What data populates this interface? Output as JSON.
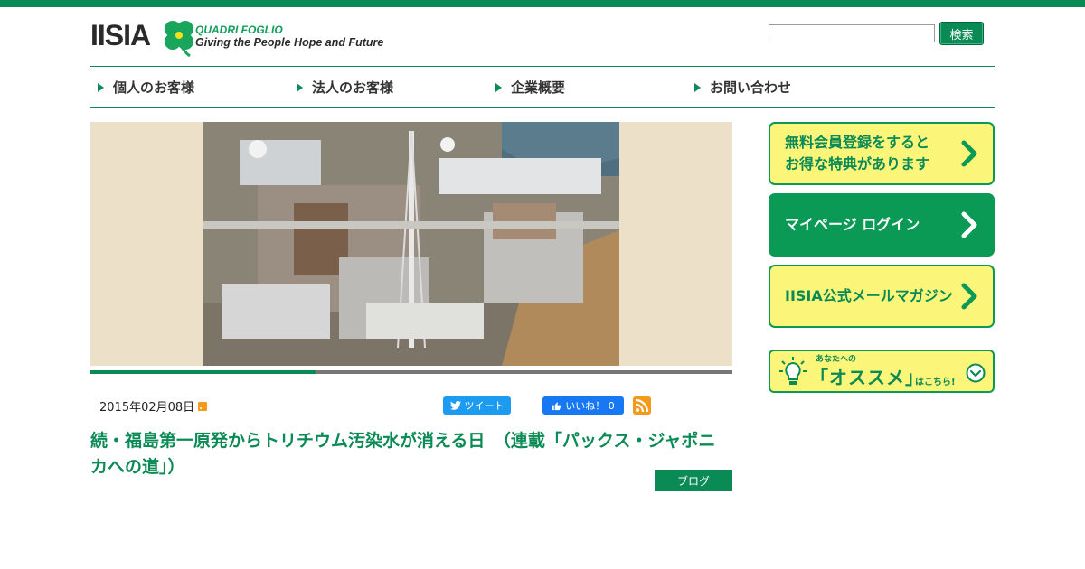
{
  "header": {
    "logo_text": "IISIA",
    "logo_sub1": "QUADRI FOGLIO",
    "logo_sub2": "Giving the People Hope and Future",
    "search_button": "検索",
    "search_value": ""
  },
  "nav": {
    "items": [
      {
        "label": "個人のお客様"
      },
      {
        "label": "法人のお客様"
      },
      {
        "label": "企業概要"
      },
      {
        "label": "お問い合わせ"
      }
    ]
  },
  "hero": {
    "slider_progress": 0.35
  },
  "post": {
    "date": "2015年02月08日",
    "tweet_label": "ツイート",
    "like_label": "いいね！ 0",
    "title": "続・福島第一原発からトリチウム汚染水が消える日　（連載「パックス・ジャポニカへの道」）",
    "category": "ブログ"
  },
  "sidebar": {
    "banners": [
      {
        "text_line1": "無料会員登録をすると",
        "text_line2": "お得な特典があります",
        "style": "yellow"
      },
      {
        "text_line1": "マイページ ログイン",
        "text_line2": "",
        "style": "green"
      },
      {
        "text_line1": "IISIA公式メールマガジン",
        "text_line2": "",
        "style": "yellow"
      }
    ],
    "reco": {
      "small": "あなたへの",
      "main": "「オススメ」",
      "tail": "はこちら!"
    }
  },
  "colors": {
    "brand_green": "#0a8a55",
    "banner_yellow": "#fbf57a",
    "hero_bg": "#ece0c8"
  }
}
